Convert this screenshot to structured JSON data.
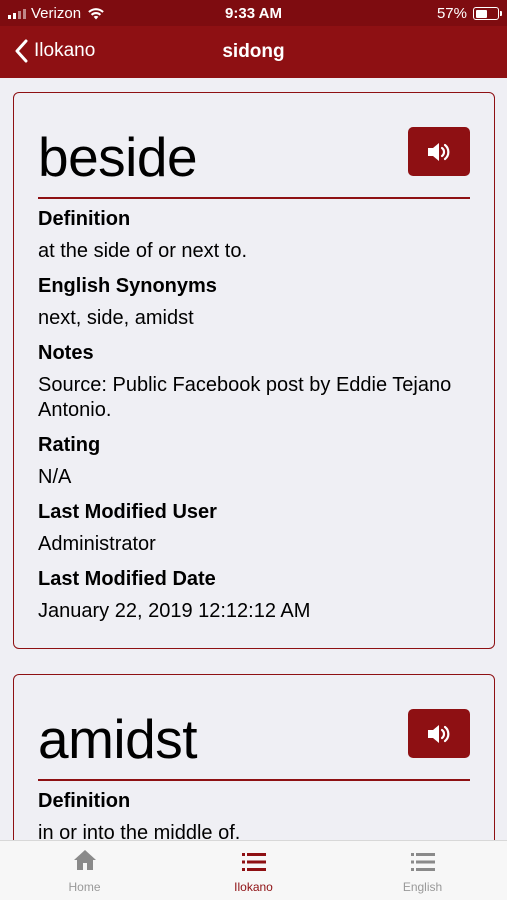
{
  "status_bar": {
    "carrier": "Verizon",
    "time": "9:33 AM",
    "battery_text": "57%",
    "battery_level": 0.57,
    "icons": [
      "signal-icon",
      "wifi-icon",
      "battery-icon"
    ]
  },
  "nav": {
    "back_label": "Ilokano",
    "title": "sidong"
  },
  "entries": [
    {
      "word": "beside",
      "fields": [
        {
          "label": "Definition",
          "value": "at the side of or next to."
        },
        {
          "label": "English Synonyms",
          "value": "next, side, amidst"
        },
        {
          "label": "Notes",
          "value": "Source: Public Facebook post by Eddie Tejano Antonio."
        },
        {
          "label": "Rating",
          "value": "N/A"
        },
        {
          "label": "Last Modified User",
          "value": "Administrator"
        },
        {
          "label": "Last Modified Date",
          "value": "January 22, 2019 12:12:12 AM"
        }
      ]
    },
    {
      "word": "amidst",
      "fields": [
        {
          "label": "Definition",
          "value": "in or into the middle of."
        }
      ]
    }
  ],
  "tabs": [
    {
      "label": "Home",
      "icon": "home-icon",
      "active": false
    },
    {
      "label": "Ilokano",
      "icon": "list-icon",
      "active": true
    },
    {
      "label": "English",
      "icon": "list-icon",
      "active": false
    }
  ],
  "colors": {
    "brand": "#8e1013",
    "status_bar": "#7e0c10",
    "background": "#efeff4",
    "tab_inactive": "#999999"
  }
}
